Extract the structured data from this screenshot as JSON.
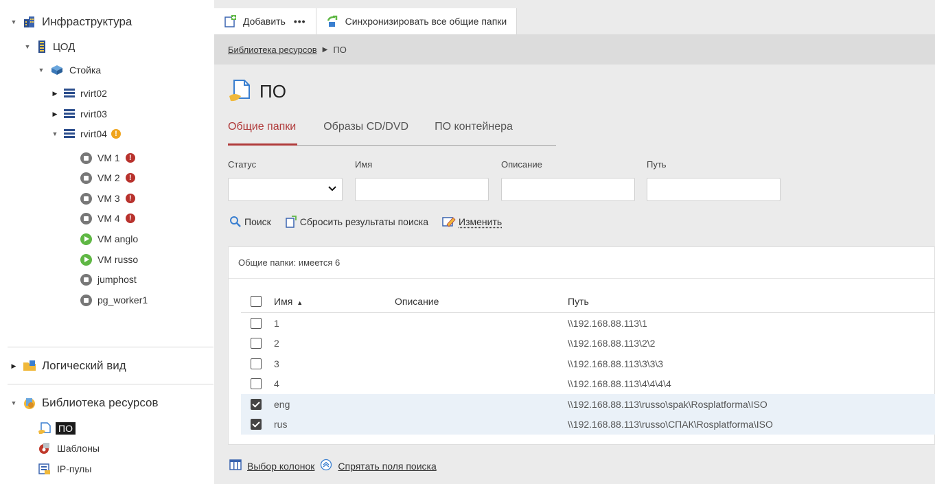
{
  "sidebar": {
    "infrastructure": "Инфраструктура",
    "datacenter": "ЦОД",
    "rack": "Стойка",
    "hosts": [
      "rvirt02",
      "rvirt03",
      "rvirt04"
    ],
    "host_warning": "!",
    "vms": [
      {
        "name": "VM 1",
        "state": "stopped",
        "error": "!"
      },
      {
        "name": "VM 2",
        "state": "stopped",
        "error": "!"
      },
      {
        "name": "VM 3",
        "state": "stopped",
        "error": "!"
      },
      {
        "name": "VM 4",
        "state": "stopped",
        "error": "!"
      },
      {
        "name": "VM anglo",
        "state": "running"
      },
      {
        "name": "VM russo",
        "state": "running"
      },
      {
        "name": "jumphost",
        "state": "stopped"
      },
      {
        "name": "pg_worker1",
        "state": "stopped"
      }
    ],
    "logical_view": "Логический вид",
    "resource_library": "Библиотека ресурсов",
    "library_items": [
      "ПО",
      "Шаблоны",
      "IP-пулы"
    ]
  },
  "toolbar": {
    "add_label": "Добавить",
    "more_label": "•••",
    "sync_label": "Синхронизировать все общие папки"
  },
  "breadcrumb": {
    "root": "Библиотека ресурсов",
    "separator": "▶",
    "current": "ПО"
  },
  "page": {
    "title": "ПО"
  },
  "tabs": [
    "Общие папки",
    "Образы CD/DVD",
    "ПО контейнера"
  ],
  "filters": {
    "status_label": "Статус",
    "name_label": "Имя",
    "description_label": "Описание",
    "path_label": "Путь",
    "status_value": "",
    "name_value": "",
    "description_value": "",
    "path_value": ""
  },
  "actions": {
    "search": "Поиск",
    "reset": "Сбросить результаты поиска",
    "edit": "Изменить"
  },
  "table": {
    "summary": "Общие папки: имеется 6",
    "headers": {
      "name": "Имя",
      "sort": "▲",
      "description": "Описание",
      "path": "Путь"
    },
    "rows": [
      {
        "name": "1",
        "description": "",
        "path": "\\\\192.168.88.113\\1",
        "checked": false
      },
      {
        "name": "2",
        "description": "",
        "path": "\\\\192.168.88.113\\2\\2",
        "checked": false
      },
      {
        "name": "3",
        "description": "",
        "path": "\\\\192.168.88.113\\3\\3\\3",
        "checked": false
      },
      {
        "name": "4",
        "description": "",
        "path": "\\\\192.168.88.113\\4\\4\\4\\4",
        "checked": false
      },
      {
        "name": "eng",
        "description": "",
        "path": "\\\\192.168.88.113\\russo\\spak\\Rosplatforma\\ISO",
        "checked": true
      },
      {
        "name": "rus",
        "description": "",
        "path": "\\\\192.168.88.113\\russo\\СПАК\\Rosplatforma\\ISO",
        "checked": true
      }
    ]
  },
  "footer": {
    "columns": "Выбор колонок",
    "hide_search": "Спрятать поля поиска"
  },
  "colors": {
    "accent_tab": "#b03a3a",
    "error": "#b8322d",
    "warning": "#f0a41c",
    "running": "#5fb744",
    "stopped": "#777777"
  }
}
